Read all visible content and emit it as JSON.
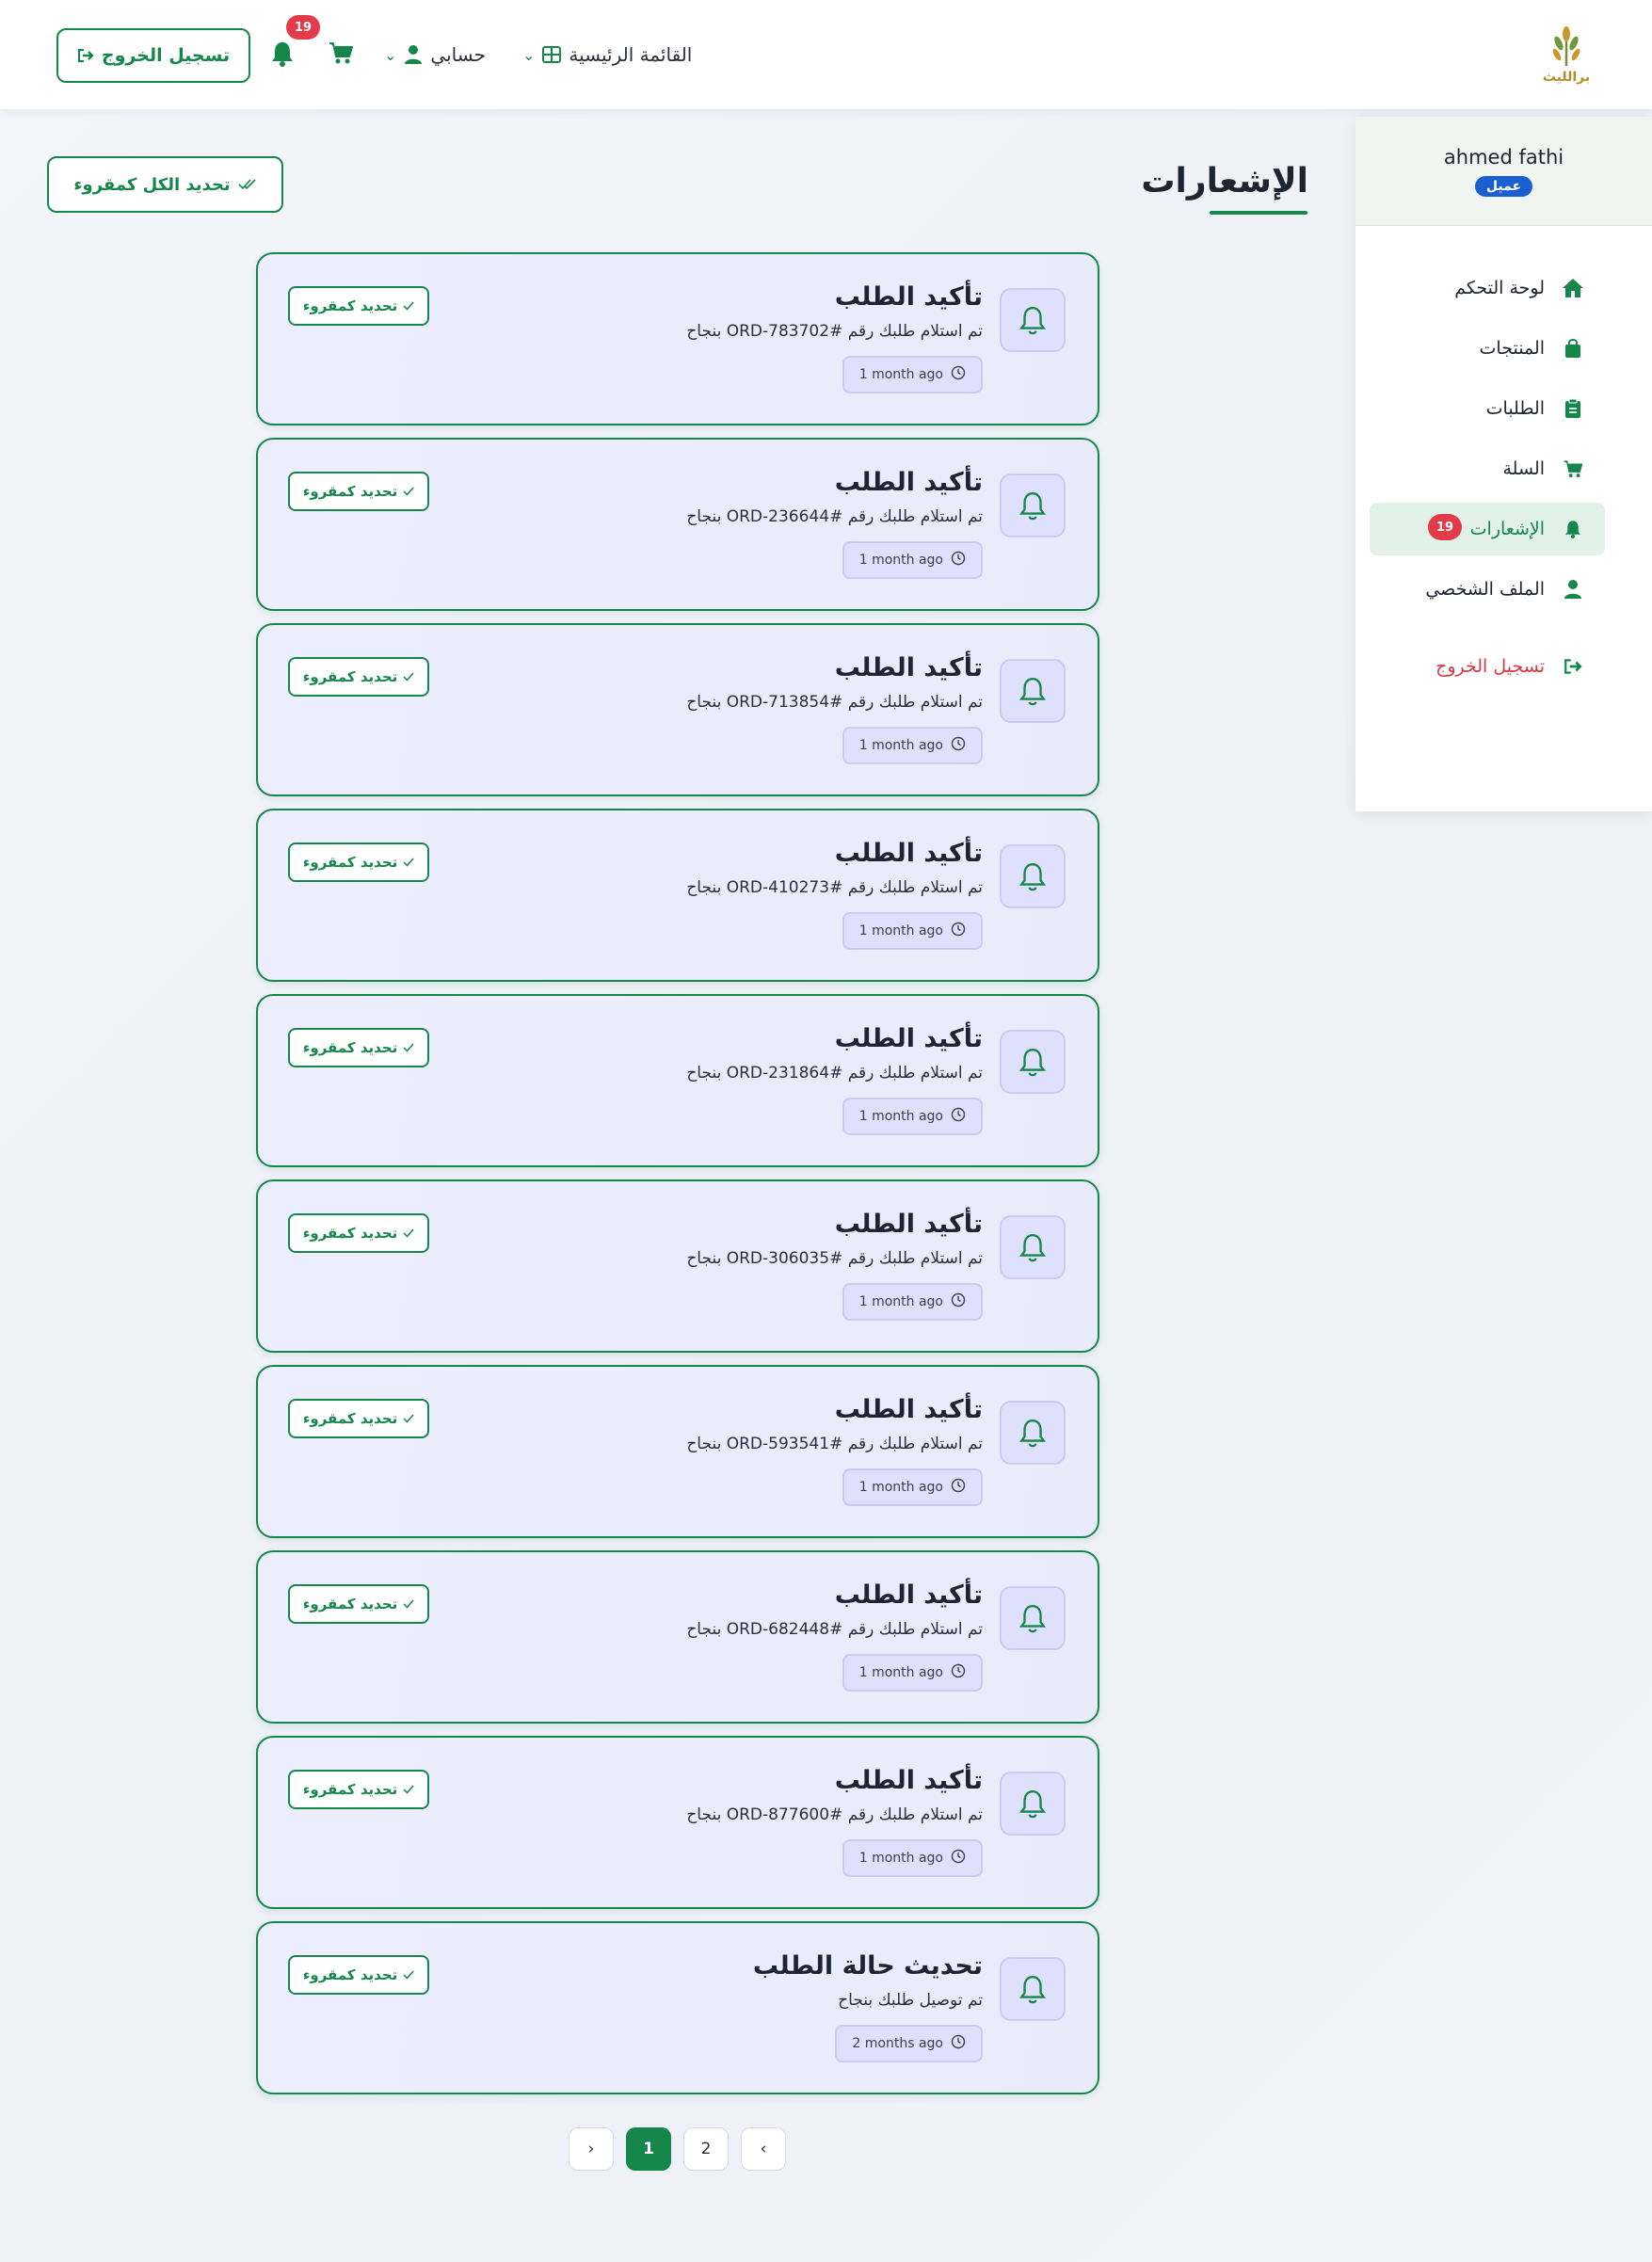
{
  "header": {
    "logo_text": "برالليث",
    "main_menu_label": "القائمة الرئيسية",
    "account_label": "حسابي",
    "notifications_count": "19",
    "logout_label": "تسجيل الخروج"
  },
  "sidebar": {
    "user_name": "ahmed fathi",
    "user_role": "عميل",
    "items": [
      {
        "label": "لوحة التحكم",
        "icon": "home-icon"
      },
      {
        "label": "المنتجات",
        "icon": "bag-icon"
      },
      {
        "label": "الطلبات",
        "icon": "clipboard-icon"
      },
      {
        "label": "السلة",
        "icon": "cart-icon"
      },
      {
        "label": "الإشعارات",
        "icon": "bell-icon",
        "badge": "19",
        "active": true
      },
      {
        "label": "الملف الشخصي",
        "icon": "user-icon"
      },
      {
        "label": "تسجيل الخروج",
        "icon": "logout-icon"
      }
    ]
  },
  "page": {
    "title": "الإشعارات",
    "mark_all_label": "تحديد الكل كمقروء"
  },
  "notifications": [
    {
      "title": "تأكيد الطلب",
      "message": "تم استلام طلبك رقم #ORD-783702 بنجاح",
      "time": "1 month ago",
      "mark_label": "تحديد كمقروء"
    },
    {
      "title": "تأكيد الطلب",
      "message": "تم استلام طلبك رقم #ORD-236644 بنجاح",
      "time": "1 month ago",
      "mark_label": "تحديد كمقروء"
    },
    {
      "title": "تأكيد الطلب",
      "message": "تم استلام طلبك رقم #ORD-713854 بنجاح",
      "time": "1 month ago",
      "mark_label": "تحديد كمقروء"
    },
    {
      "title": "تأكيد الطلب",
      "message": "تم استلام طلبك رقم #ORD-410273 بنجاح",
      "time": "1 month ago",
      "mark_label": "تحديد كمقروء"
    },
    {
      "title": "تأكيد الطلب",
      "message": "تم استلام طلبك رقم #ORD-231864 بنجاح",
      "time": "1 month ago",
      "mark_label": "تحديد كمقروء"
    },
    {
      "title": "تأكيد الطلب",
      "message": "تم استلام طلبك رقم #ORD-306035 بنجاح",
      "time": "1 month ago",
      "mark_label": "تحديد كمقروء"
    },
    {
      "title": "تأكيد الطلب",
      "message": "تم استلام طلبك رقم #ORD-593541 بنجاح",
      "time": "1 month ago",
      "mark_label": "تحديد كمقروء"
    },
    {
      "title": "تأكيد الطلب",
      "message": "تم استلام طلبك رقم #ORD-682448 بنجاح",
      "time": "1 month ago",
      "mark_label": "تحديد كمقروء"
    },
    {
      "title": "تأكيد الطلب",
      "message": "تم استلام طلبك رقم #ORD-877600 بنجاح",
      "time": "1 month ago",
      "mark_label": "تحديد كمقروء"
    },
    {
      "title": "تحديث حالة الطلب",
      "message": "تم توصيل طلبك بنجاح",
      "time": "2 months ago",
      "mark_label": "تحديد كمقروء"
    }
  ],
  "pagination": {
    "pages": [
      "1",
      "2"
    ],
    "current": "1"
  }
}
